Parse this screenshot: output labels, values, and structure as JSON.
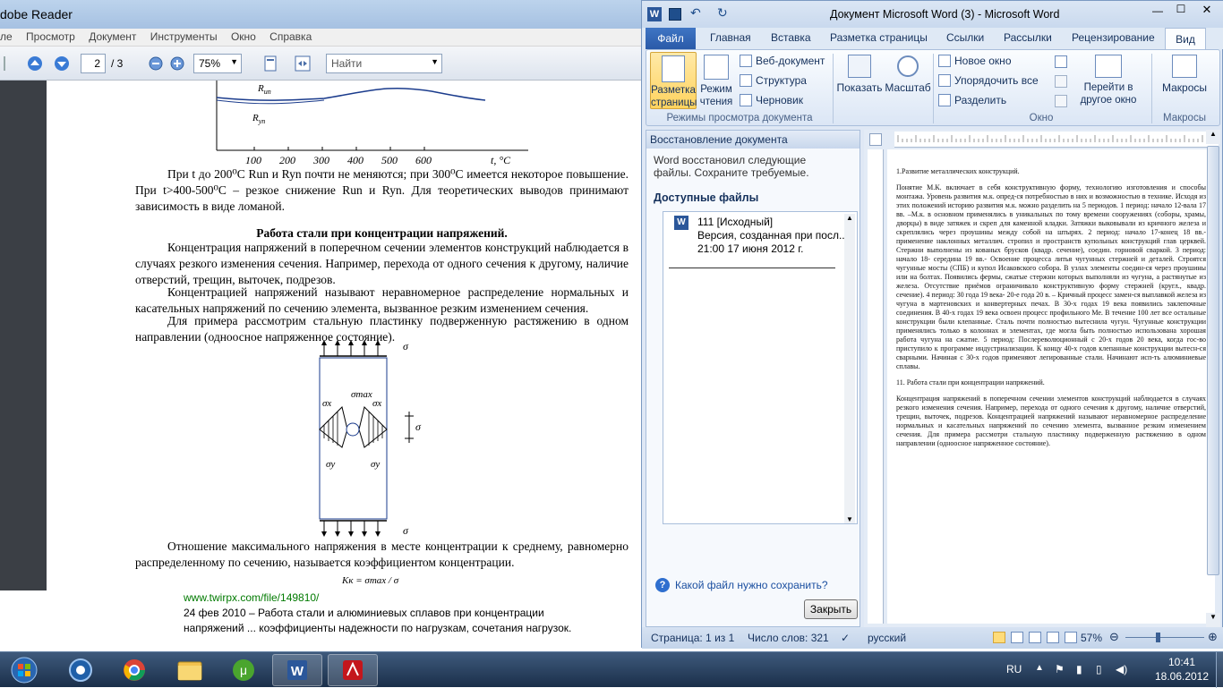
{
  "reader": {
    "title_fragment": "dobe Reader",
    "menu": [
      "ле",
      "Просмотр",
      "Документ",
      "Инструменты",
      "Окно",
      "Справка"
    ],
    "page_current": "2",
    "page_total": "/ 3",
    "zoom": "75%",
    "find_placeholder": "Найти",
    "graph": {
      "label_un": "R",
      "label_un_sub": "un",
      "label_yn": "R",
      "label_yn_sub": "yn",
      "ticks": [
        "100",
        "200",
        "300",
        "400",
        "500",
        "600"
      ],
      "axis_label": "t, °C"
    },
    "para1": "При t до 200⁰С Run и Ryn почти не меняются; при 300⁰С имеется некоторое повышение. При t>400-500⁰С – резкое снижение Run и Ryn. Для теоретических выводов принимают зависимость в виде ломаной.",
    "heading": "Работа стали при концентрации напряжений.",
    "para2": "Концентрация напряжений в поперечном сечении элементов конструкций наблюдается в случаях резкого изменения сечения. Например, перехода от одного сечения к другому, наличие отверстий, трещин, выточек, подрезов.",
    "para3": "Концентрацией напряжений называют неравномерное распределение нормальных и касательных напряжений по сечению элемента, вызванное резким изменением сечения.",
    "para4": "Для примера рассмотрим стальную пластинку подверженную растяжению в одном направлении (одноосное напряженное состояние).",
    "figure": {
      "sigma": "σ",
      "sigma_max": "σmax",
      "sigma_x": "σx",
      "sigma_y": "σy"
    },
    "para5": "Отношение максимального напряжения в месте концентрации к среднему, равномерно распределенному по сечению, называется коэффициентом концентрации.",
    "formula": "Kк = σmax / σ"
  },
  "search_result": {
    "url": "www.twirpx.com/file/149810/",
    "line1": "24 фев 2010 – Работа стали и алюминиевых сплавов при концентрации",
    "line2": "напряжений ... коэффициенты надежности по нагрузкам, сочетания нагрузок."
  },
  "word": {
    "title": "Документ Microsoft Word (3)  -  Microsoft Word",
    "tabs": [
      "Файл",
      "Главная",
      "Вставка",
      "Разметка страницы",
      "Ссылки",
      "Рассылки",
      "Рецензирование",
      "Вид"
    ],
    "ribbon": {
      "page_layout": "Разметка страницы",
      "reading": "Режим чтения",
      "web": "Веб-документ",
      "structure": "Структура",
      "draft": "Черновик",
      "group_views": "Режимы просмотра документа",
      "show": "Показать",
      "zoom": "Масштаб",
      "new_window": "Новое окно",
      "arrange_all": "Упорядочить все",
      "split": "Разделить",
      "switch_window": "Перейти в другое окно",
      "group_window": "Окно",
      "macros": "Макросы",
      "group_macros": "Макросы"
    },
    "recovery": {
      "header": "Восстановление документа",
      "message": "Word восстановил следующие файлы. Сохраните требуемые.",
      "available": "Доступные файлы",
      "file_name": "111  [Исходный]",
      "file_desc": "Версия, созданная при посл...",
      "file_date": "21:00 17 июня 2012 г.",
      "help_link": "Какой файл нужно сохранить?",
      "close_button": "Закрыть"
    },
    "doc": {
      "heading1": "1.Развитие металлических конструкций.",
      "p1": "Понятие М.К. включает в себя конструктивную форму, технологию изготовления и способы монтажа. Уровень развития м.к. опред-ся потребностью в них и возможностью в технике. Исходя из этих положений историю развития м.к. можно разделить на 5 периодов. 1 период: начало 12-вала 17 вв. –М.к. в основном применялись в уникальных по тому времени сооружениях (соборы, храмы, дворцы) в виде затяжек и скреп для каменной кладки. Затяжки выковывали из кричного железа и скреплялись через проушины между собой на штырях. 2 период: начало 17-конец 18 вв.- применение наклонных металлич. стропил и пространств купольных конструкций глав церквей. Стержни выполнены из кованых брусков (квадр. сечение), соедин. горновой сваркой. 3 период: начало 18- середина 19 вв.- Освоение процесса литья чугунных стержней и деталей. Строятся чугунные мосты (СПБ) и купол Исаковского собора. В узлах элементы соедин-ся через проушины или на болтах. Появились фермы, сжатые стержни которых выполняли из чугуна, а растянутые из железа. Отсутствие приёмов ограничивало конструктивную форму стержней (кругл., квадр. сечение). 4 период: 30 года 19 века- 20-е года 20 в. – Кричный процесс замен-ся выплавкой железа из чугуна в мартеновских и конвертерных печах. В 30-х годах 19 века появились заклепочные соединения. В 40-х годах 19 века освоен процесс профильного Ме. В течение 100 лет все остальные конструкции были клепанные. Сталь почти полностью вытеснила чугун. Чугунные конструкции применялись только в колоннах и элементах, где могла быть полностью использована хорошая работа чугуна на сжатие. 5 период: Послереволюционный с 20-х годов 20 века, когда гос-во приступило к программе индустриализации. К концу 40-х годов клепанные конструкции вытесн-ся сварными. Начиная с 30-х годов применяют легированные стали. Начинают исп-ть алюминиевые сплавы.",
      "heading2": "11. Работа стали при концентрации напряжений.",
      "p2": "Концентрация напряжений в поперечном сечении элементов конструкций наблюдается в случаях резкого изменения сечения. Например, перехода от одного сечения к другому, наличие отверстий, трещин, выточек, подрезов. Концентрацией напряжений называют неравномерное распределение нормальных и касательных напряжений по сечению элемента, вызванное резким изменением сечения. Для примера рассмотри стальную пластинку подверженную растяжению в одном направлении (одноосное напряженное состояние)."
    },
    "status": {
      "page": "Страница: 1 из 1",
      "words": "Число слов: 321",
      "language": "русский",
      "zoom": "57%"
    }
  },
  "taskbar": {
    "apps": [
      "Windows Start",
      "Chrome",
      "File Explorer",
      "uTorrent",
      "Microsoft Word",
      "Adobe Reader"
    ],
    "tray": {
      "language": "RU",
      "time": "10:41",
      "date": "18.06.2012"
    }
  },
  "colors": {
    "ribbon_text": "#15315c",
    "link": "#1b4fa0",
    "url_green": "#007a00",
    "taskbar": "#1b2f4a"
  }
}
